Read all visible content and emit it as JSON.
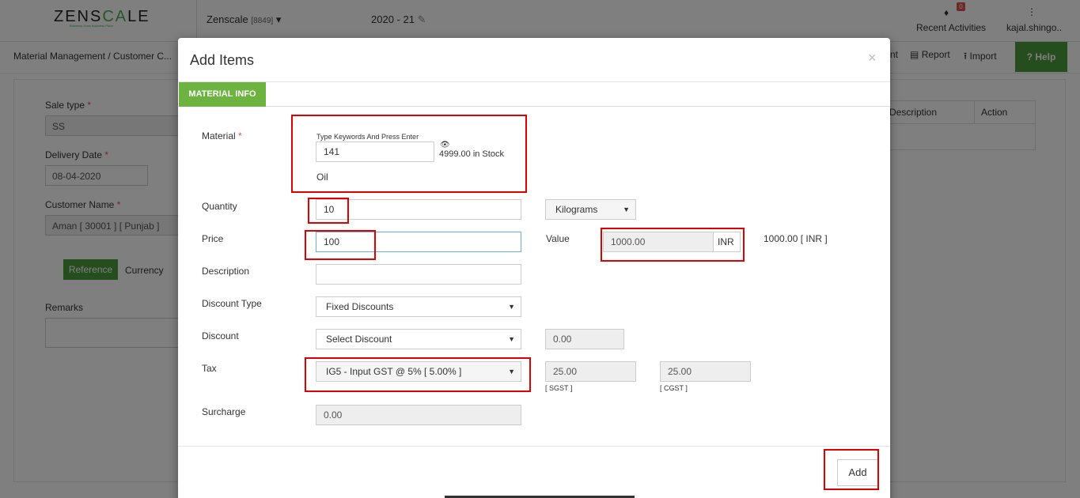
{
  "app": {
    "logo_pre": "ZENS",
    "logo_hl": "CA",
    "logo_post": "LE",
    "logo_tagline": "Business Goes Business Place",
    "company": "Zenscale",
    "company_code": "[8849]",
    "year": "2020 - 21",
    "recent_activities": "Recent Activities",
    "notification_count": "0",
    "user": "kajal.shingo..",
    "breadcrumb": "Material Management  / Customer C...",
    "actions": [
      "nt",
      "Report",
      "Import"
    ],
    "help": "Help"
  },
  "background_form": {
    "sale_type_label": "Sale type",
    "sale_type_value": "SS",
    "delivery_date_label": "Delivery Date",
    "delivery_date_value": "08-04-2020",
    "customer_label": "Customer Name",
    "customer_value": "Aman [ 30001 ] [ Punjab ]",
    "reference_tab": "Reference",
    "currency_tab": "Currency",
    "remarks_label": "Remarks",
    "table_headers": [
      "Description",
      "Action"
    ]
  },
  "modal": {
    "title": "Add Items",
    "close": "×",
    "tab": "MATERIAL INFO",
    "material": {
      "label": "Material",
      "hint": "Type Keywords And Press Enter",
      "value": "141",
      "stock": "4999.00 in Stock",
      "name": "Oil"
    },
    "quantity": {
      "label": "Quantity",
      "value": "10",
      "unit": "Kilograms"
    },
    "price": {
      "label": "Price",
      "value": "100"
    },
    "value": {
      "label": "Value",
      "amount": "1000.00",
      "currency": "INR",
      "summary": "1000.00 [ INR ]"
    },
    "description": {
      "label": "Description",
      "value": ""
    },
    "discount_type": {
      "label": "Discount Type",
      "value": "Fixed Discounts"
    },
    "discount": {
      "label": "Discount",
      "value": "Select Discount",
      "amount": "0.00"
    },
    "tax": {
      "label": "Tax",
      "value": "IG5 - Input GST @ 5% [ 5.00% ]",
      "sgst_value": "25.00",
      "sgst_label": "[ SGST ]",
      "cgst_value": "25.00",
      "cgst_label": "[ CGST ]"
    },
    "surcharge": {
      "label": "Surcharge",
      "value": "0.00"
    },
    "add_button": "Add"
  },
  "icons": {
    "dropdown": "▾",
    "edit": "✎",
    "bell": "🔔",
    "kebab": "⋮",
    "eye": "👁",
    "report": "▤",
    "import": "⭱",
    "help": "?"
  },
  "colors": {
    "brand_green": "#4a9a3c",
    "tab_green": "#6cb33f",
    "highlight_red": "#e00000"
  }
}
